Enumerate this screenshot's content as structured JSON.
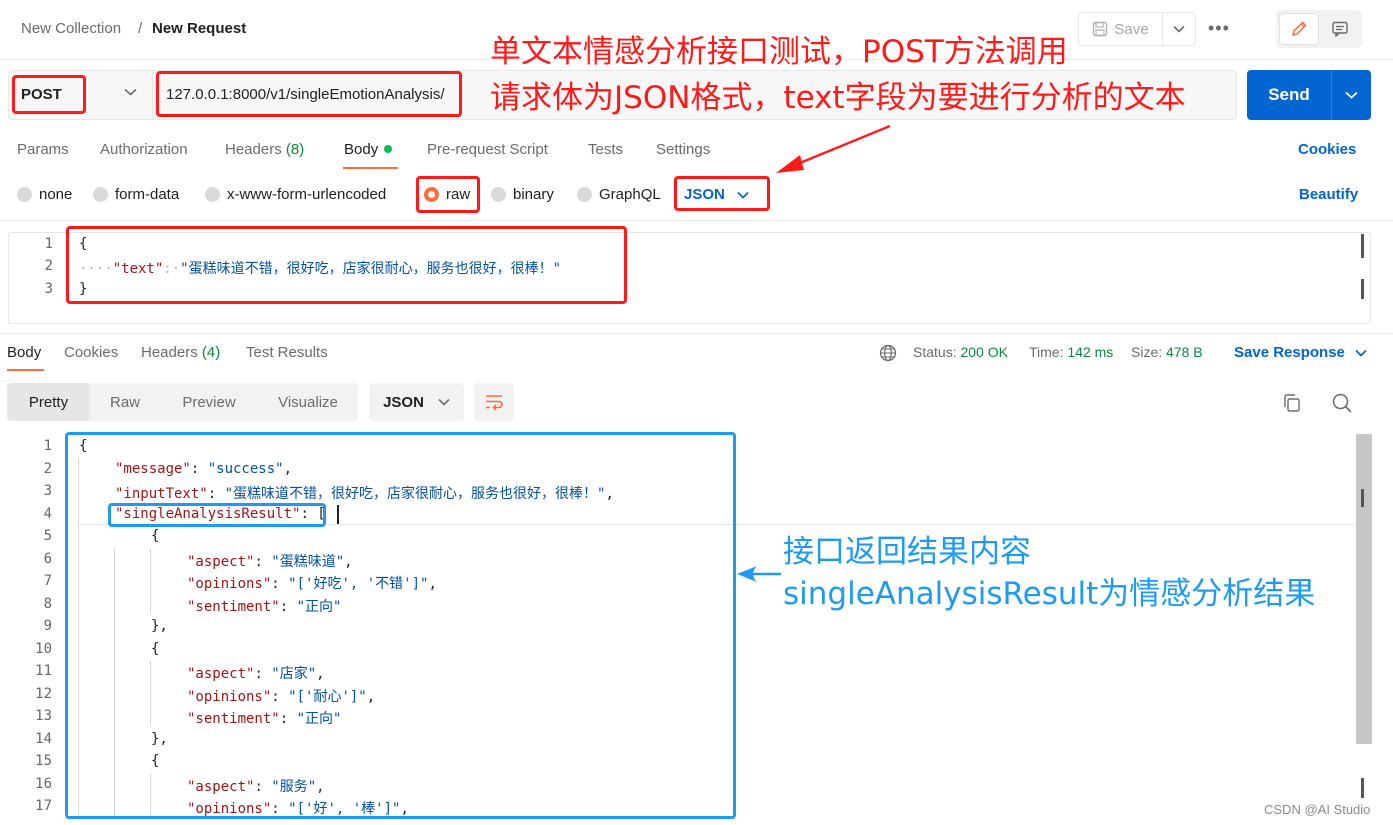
{
  "header": {
    "collection": "New Collection",
    "separator": "/",
    "request_name": "New Request",
    "save_label": "Save",
    "more_label": "•••"
  },
  "url_bar": {
    "method": "POST",
    "url": "127.0.0.1:8000/v1/singleEmotionAnalysis/",
    "send_label": "Send"
  },
  "request_tabs": {
    "params": "Params",
    "authorization": "Authorization",
    "headers": "Headers",
    "headers_count": "(8)",
    "body": "Body",
    "prerequest": "Pre-request Script",
    "tests": "Tests",
    "settings": "Settings",
    "cookies": "Cookies"
  },
  "body_types": {
    "none": "none",
    "form_data": "form-data",
    "urlencoded": "x-www-form-urlencoded",
    "raw": "raw",
    "binary": "binary",
    "graphql": "GraphQL",
    "language": "JSON",
    "beautify": "Beautify"
  },
  "request_body": {
    "line_numbers": [
      "1",
      "2",
      "3"
    ],
    "open_brace": "{",
    "indent_dots": "····",
    "key": "\"text\"",
    "colon": ":·",
    "value": "\"蛋糕味道不错，很好吃，店家很耐心，服务也很好，很棒！\"",
    "close_brace": "}"
  },
  "response_tabs": {
    "body": "Body",
    "cookies": "Cookies",
    "headers": "Headers",
    "headers_count": "(4)",
    "test_results": "Test Results"
  },
  "response_status": {
    "status_label": "Status:",
    "status_value": "200 OK",
    "time_label": "Time:",
    "time_value": "142 ms",
    "size_label": "Size:",
    "size_value": "478 B",
    "save_response": "Save Response"
  },
  "response_view": {
    "pretty": "Pretty",
    "raw": "Raw",
    "preview": "Preview",
    "visualize": "Visualize",
    "format": "JSON"
  },
  "response_body": {
    "lines": [
      {
        "n": "1",
        "indent": 0,
        "parts": [
          [
            "p",
            "{"
          ]
        ]
      },
      {
        "n": "2",
        "indent": 1,
        "parts": [
          [
            "k",
            "\"message\""
          ],
          [
            "p",
            ": "
          ],
          [
            "s",
            "\"success\""
          ],
          [
            "p",
            ","
          ]
        ]
      },
      {
        "n": "3",
        "indent": 1,
        "parts": [
          [
            "k",
            "\"inputText\""
          ],
          [
            "p",
            ": "
          ],
          [
            "s",
            "\"蛋糕味道不错，很好吃，店家很耐心，服务也很好，很棒！\""
          ],
          [
            "p",
            ","
          ]
        ]
      },
      {
        "n": "4",
        "indent": 1,
        "parts": [
          [
            "k",
            "\"singleAnalysisResult\""
          ],
          [
            "p",
            ": ["
          ]
        ]
      },
      {
        "n": "5",
        "indent": 2,
        "parts": [
          [
            "p",
            "{"
          ]
        ]
      },
      {
        "n": "6",
        "indent": 3,
        "parts": [
          [
            "k",
            "\"aspect\""
          ],
          [
            "p",
            ": "
          ],
          [
            "s",
            "\"蛋糕味道\""
          ],
          [
            "p",
            ","
          ]
        ]
      },
      {
        "n": "7",
        "indent": 3,
        "parts": [
          [
            "k",
            "\"opinions\""
          ],
          [
            "p",
            ": "
          ],
          [
            "s",
            "\"['好吃', '不错']\""
          ],
          [
            "p",
            ","
          ]
        ]
      },
      {
        "n": "8",
        "indent": 3,
        "parts": [
          [
            "k",
            "\"sentiment\""
          ],
          [
            "p",
            ": "
          ],
          [
            "s",
            "\"正向\""
          ]
        ]
      },
      {
        "n": "9",
        "indent": 2,
        "parts": [
          [
            "p",
            "},"
          ]
        ]
      },
      {
        "n": "10",
        "indent": 2,
        "parts": [
          [
            "p",
            "{"
          ]
        ]
      },
      {
        "n": "11",
        "indent": 3,
        "parts": [
          [
            "k",
            "\"aspect\""
          ],
          [
            "p",
            ": "
          ],
          [
            "s",
            "\"店家\""
          ],
          [
            "p",
            ","
          ]
        ]
      },
      {
        "n": "12",
        "indent": 3,
        "parts": [
          [
            "k",
            "\"opinions\""
          ],
          [
            "p",
            ": "
          ],
          [
            "s",
            "\"['耐心']\""
          ],
          [
            "p",
            ","
          ]
        ]
      },
      {
        "n": "13",
        "indent": 3,
        "parts": [
          [
            "k",
            "\"sentiment\""
          ],
          [
            "p",
            ": "
          ],
          [
            "s",
            "\"正向\""
          ]
        ]
      },
      {
        "n": "14",
        "indent": 2,
        "parts": [
          [
            "p",
            "},"
          ]
        ]
      },
      {
        "n": "15",
        "indent": 2,
        "parts": [
          [
            "p",
            "{"
          ]
        ]
      },
      {
        "n": "16",
        "indent": 3,
        "parts": [
          [
            "k",
            "\"aspect\""
          ],
          [
            "p",
            ": "
          ],
          [
            "s",
            "\"服务\""
          ],
          [
            "p",
            ","
          ]
        ]
      },
      {
        "n": "17",
        "indent": 3,
        "parts": [
          [
            "k",
            "\"opinions\""
          ],
          [
            "p",
            ": "
          ],
          [
            "s",
            "\"['好', '棒']\""
          ],
          [
            "p",
            ","
          ]
        ]
      }
    ]
  },
  "annotations": {
    "top_line1": "单文本情感分析接口测试，POST方法调用",
    "top_line2": "请求体为JSON格式，text字段为要进行分析的文本",
    "right_line1": "接口返回结果内容",
    "right_line2": "singleAnalysisResult为情感分析结果",
    "red_color": "#ff1a1a",
    "blue_color": "#1e9bf0"
  },
  "colors": {
    "accent_orange": "#ff6c37",
    "send_blue": "#0265d2",
    "status_green": "#0a8a3e",
    "json_key": "#a31515",
    "json_string": "#0451a5"
  },
  "watermark": "CSDN @AI Studio"
}
